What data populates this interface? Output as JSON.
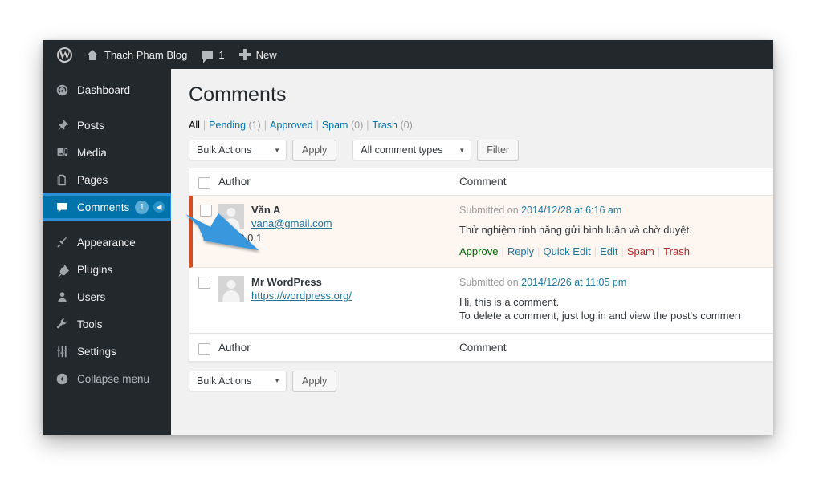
{
  "adminbar": {
    "logo": "wordpress-logo",
    "site_name": "Thach Pham Blog",
    "comment_count": "1",
    "new_label": "New"
  },
  "sidebar": {
    "items": [
      {
        "label": "Dashboard",
        "icon": "dashboard-icon",
        "active": false
      },
      {
        "label": "Posts",
        "icon": "pin-icon",
        "active": false
      },
      {
        "label": "Media",
        "icon": "media-icon",
        "active": false
      },
      {
        "label": "Pages",
        "icon": "pages-icon",
        "active": false
      },
      {
        "label": "Comments",
        "icon": "comment-bubble-icon",
        "active": true,
        "badge": "1"
      },
      {
        "label": "Appearance",
        "icon": "brush-icon",
        "active": false
      },
      {
        "label": "Plugins",
        "icon": "plug-icon",
        "active": false
      },
      {
        "label": "Users",
        "icon": "user-icon",
        "active": false
      },
      {
        "label": "Tools",
        "icon": "wrench-icon",
        "active": false
      },
      {
        "label": "Settings",
        "icon": "sliders-icon",
        "active": false
      },
      {
        "label": "Collapse menu",
        "icon": "collapse-arrow-icon",
        "active": false
      }
    ]
  },
  "page": {
    "title": "Comments"
  },
  "filters": {
    "all": "All",
    "pending": "Pending",
    "pending_count": "(1)",
    "approved": "Approved",
    "spam": "Spam",
    "spam_count": "(0)",
    "trash": "Trash",
    "trash_count": "(0)"
  },
  "tablenav": {
    "bulk_actions": "Bulk Actions",
    "apply": "Apply",
    "comment_types": "All comment types",
    "filter": "Filter"
  },
  "table": {
    "headers": {
      "author": "Author",
      "comment": "Comment"
    },
    "rows": [
      {
        "status": "pending",
        "author_name": "Văn A",
        "author_link": "vana@gmail.com",
        "author_ip": "127.0.0.1",
        "submitted_prefix": "Submitted on",
        "submitted_date": "2014/12/28 at 6:16 am",
        "body": "Thử nghiệm tính năng gửi bình luận và chờ duyệt.",
        "actions": [
          "Approve",
          "Reply",
          "Quick Edit",
          "Edit",
          "Spam",
          "Trash"
        ]
      },
      {
        "status": "approved",
        "author_name": "Mr WordPress",
        "author_link": "https://wordpress.org/",
        "author_ip": "",
        "submitted_prefix": "Submitted on",
        "submitted_date": "2014/12/26 at 11:05 pm",
        "body_line1": "Hi, this is a comment.",
        "body_line2": "To delete a comment, just log in and view the post's commen"
      }
    ]
  },
  "bottomnav": {
    "bulk_actions": "Bulk Actions",
    "apply": "Apply"
  },
  "annotation": {
    "highlight_color": "#2a8fd4",
    "arrow_color": "#3897dd",
    "target": "sidebar-item-comments"
  }
}
